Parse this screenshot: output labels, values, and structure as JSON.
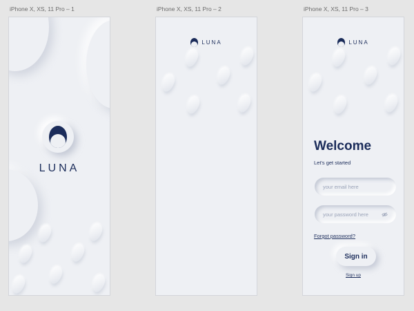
{
  "frames": [
    {
      "label": "iPhone X, XS, 11 Pro – 1",
      "logo_text": "LUNA"
    },
    {
      "label": "iPhone X, XS, 11 Pro – 2",
      "logo_text": "LUNA"
    },
    {
      "label": "iPhone X, XS, 11 Pro – 3",
      "logo_text": "LUNA"
    }
  ],
  "login": {
    "title": "Welcome",
    "subtitle": "Let's get started",
    "email_placeholder": "your email here",
    "password_placeholder": "your password here",
    "forgot_label": "Forgot password?",
    "signin_label": "Sign in",
    "signup_label": "Sign up"
  },
  "icons": {
    "logo": "moon-icon",
    "password_toggle": "eye-off-icon"
  },
  "colors": {
    "canvas_bg": "#e6e6e6",
    "artboard_bg": "#eef0f4",
    "brand_navy": "#1b2c5a",
    "placeholder": "#9aa3b8"
  }
}
